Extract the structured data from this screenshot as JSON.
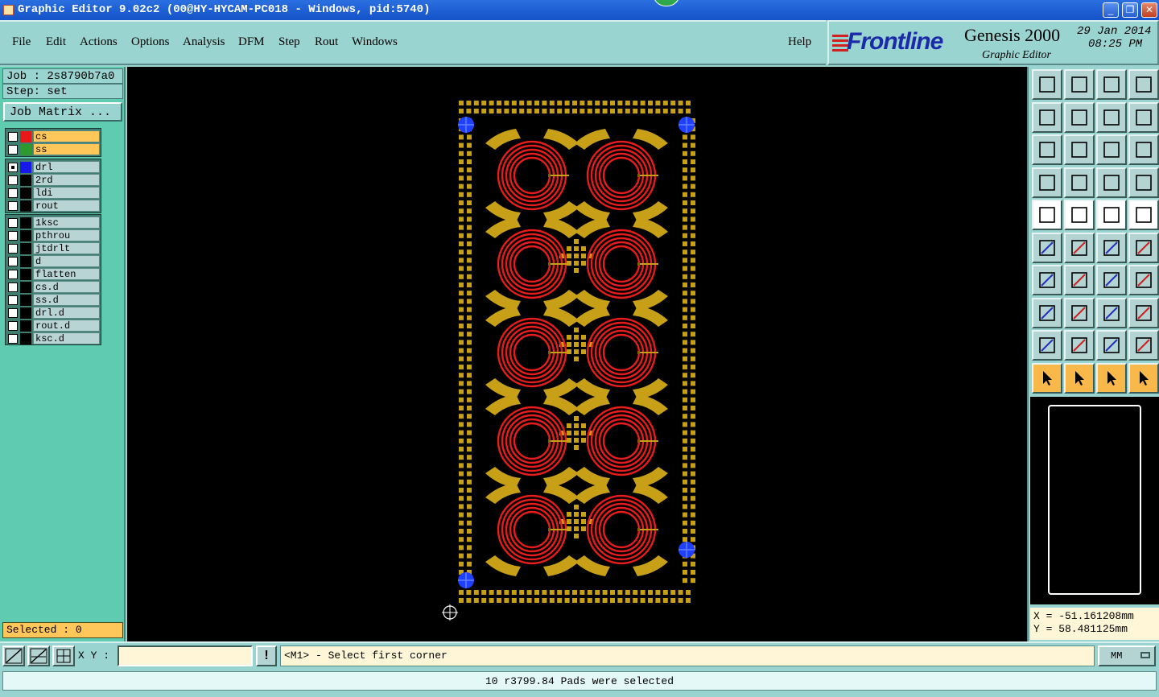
{
  "window": {
    "title": "Graphic Editor 9.02c2 (00@HY-HYCAM-PC018 - Windows, pid:5740)",
    "minimize_label": "_",
    "restore_label": "❐",
    "close_label": "✕"
  },
  "menu": {
    "file": "File",
    "edit": "Edit",
    "actions": "Actions",
    "options": "Options",
    "analysis": "Analysis",
    "dfm": "DFM",
    "step": "Step",
    "rout": "Rout",
    "windows": "Windows",
    "help": "Help"
  },
  "brand": {
    "logo": "Frontline",
    "product": "Genesis 2000",
    "subtitle": "Graphic Editor",
    "date": "29 Jan 2014",
    "time": "08:25 PM"
  },
  "job": {
    "job_label": "Job : 2s8790b7a0",
    "step_label": "Step: set",
    "job_matrix": "Job Matrix ..."
  },
  "layers": {
    "board": [
      {
        "name": "cs",
        "color": "#e81818",
        "checked": false
      },
      {
        "name": "ss",
        "color": "#2c9a2c",
        "checked": false
      }
    ],
    "drill": [
      {
        "name": "drl",
        "color": "#1818e8",
        "checked": true
      },
      {
        "name": "2rd",
        "color": "#000000",
        "checked": false
      },
      {
        "name": "ldi",
        "color": "#000000",
        "checked": false
      },
      {
        "name": "rout",
        "color": "#000000",
        "checked": false
      }
    ],
    "misc": [
      {
        "name": "1ksc"
      },
      {
        "name": "pthrou"
      },
      {
        "name": "jtdrlt"
      },
      {
        "name": "d"
      },
      {
        "name": "flatten"
      },
      {
        "name": "cs.d"
      },
      {
        "name": "ss.d"
      },
      {
        "name": "drl.d"
      },
      {
        "name": "rout.d"
      },
      {
        "name": "ksc.d"
      }
    ]
  },
  "selected": "Selected : 0",
  "coords": {
    "x": "X  = -51.161208mm",
    "y": "Y  =  58.481125mm"
  },
  "command": {
    "xy_label": "X Y :",
    "xy_value": "",
    "exclaim": "!",
    "prompt": "<M1> - Select first corner",
    "units": "MM"
  },
  "status": "10 r3799.84 Pads were selected",
  "colors": {
    "copper": "#c8a018",
    "coil": "#e81c1c",
    "drill": "#2040ff",
    "panel": "#9ad4d0"
  }
}
